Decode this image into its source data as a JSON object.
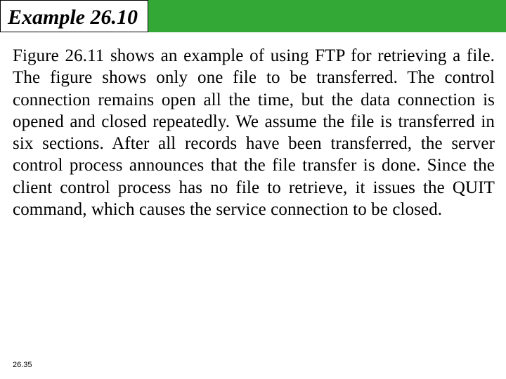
{
  "header": {
    "title": "Example 26.10"
  },
  "body": {
    "paragraph": "Figure 26.11 shows an example of using FTP for retrieving a file. The figure shows only one file to be transferred. The control connection remains open all the time, but the data connection is opened and closed repeatedly. We assume the file is transferred in six sections. After all records have been transferred, the server control process announces that the file transfer is done. Since the client control process has no file to retrieve, it issues the QUIT command, which causes the service connection to be closed."
  },
  "footer": {
    "page_number": "26.35"
  }
}
